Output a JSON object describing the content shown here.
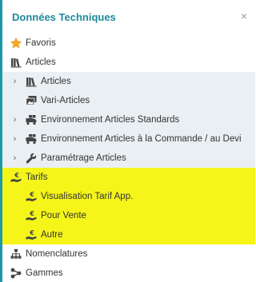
{
  "panel": {
    "title": "Données Techniques",
    "close_glyph": "×"
  },
  "tree": {
    "favoris": {
      "label": "Favoris",
      "icon": "star-icon"
    },
    "articles": {
      "label": "Articles",
      "icon": "books-icon",
      "children": [
        {
          "label": "Articles",
          "icon": "books-icon",
          "expander": "›"
        },
        {
          "label": "Vari-Articles",
          "icon": "image-stack-icon"
        },
        {
          "label": "Environnement Articles Standards",
          "icon": "truck-icon",
          "expander": "›"
        },
        {
          "label": "Environnement Articles à la Commande / au Devi",
          "icon": "truck-icon",
          "expander": "›"
        },
        {
          "label": "Paramétrage Articles",
          "icon": "wrench-icon",
          "expander": "›"
        }
      ]
    },
    "tarifs": {
      "label": "Tarifs",
      "icon": "hand-euro-icon",
      "children": [
        {
          "label": "Visualisation Tarif App.",
          "icon": "hand-euro-icon"
        },
        {
          "label": "Pour Vente",
          "icon": "hand-euro-icon"
        },
        {
          "label": "Autre",
          "icon": "hand-euro-icon"
        }
      ]
    },
    "nomenclatures": {
      "label": "Nomenclatures",
      "icon": "hierarchy-icon"
    },
    "gammes": {
      "label": "Gammes",
      "icon": "share-nodes-icon"
    }
  },
  "colors": {
    "accent": "#1e9aa6",
    "title": "#1e8a9a",
    "highlight": "#f5f51a",
    "submenu_bg": "#eaeff3"
  }
}
